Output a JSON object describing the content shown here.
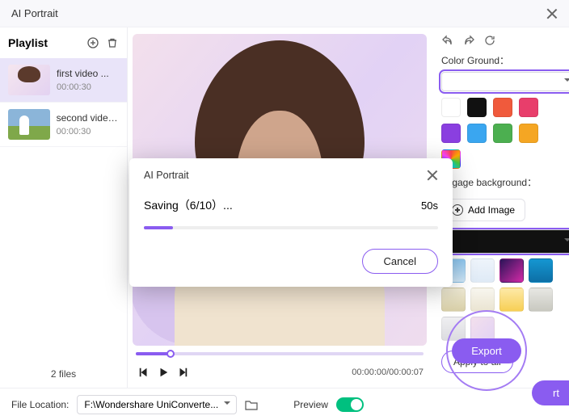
{
  "window": {
    "title": "AI Portrait"
  },
  "sidebar": {
    "label": "Playlist",
    "items": [
      {
        "name": "first video ...",
        "duration": "00:00:30"
      },
      {
        "name": "second video...",
        "duration": "00:00:30"
      }
    ],
    "file_count": "2 files"
  },
  "player": {
    "time_current": "00:00:00",
    "time_total": "00:00:07",
    "time_display": "00:00:00/00:00:07"
  },
  "right": {
    "color_ground_label": "Color Ground：",
    "image_bg_label": "Imgage background：",
    "add_image_label": "Add Image",
    "apply_all_label": "Apply to all",
    "export_label": "Export",
    "secondary_rt_label": "rt",
    "swatches": [
      "#ffffff",
      "#ffffff",
      "#111111",
      "#f05a3c",
      "#e83e6b",
      "#8a3fe0",
      "#3aa6f0",
      "#4caf50",
      "#f5a623",
      "rainbow"
    ],
    "bg_thumbs": [
      "#111111",
      "linear-gradient(135deg,#f6d5e8,#efe1f4)",
      "linear-gradient(135deg,#2e9e7a,#d3864e)",
      "linear-gradient(#1f4d7a,#0c2a47)",
      "linear-gradient(#8dc7f0,#cfe6f7)",
      "linear-gradient(#eef4fb,#dfeaf6)",
      "linear-gradient(135deg,#2a1458,#d32aa7)",
      "linear-gradient(#1596d1,#0d6fa6)",
      "linear-gradient(#f1ecd6,#d8cfa8)",
      "linear-gradient(#f8f6ef,#eae4d1)",
      "linear-gradient(#fde9a7,#f7cf55)",
      "linear-gradient(#e7e7e3,#c8c8c0)",
      "linear-gradient(#efeff1,#dcdce0)",
      "linear-gradient(135deg,#f3e0ec,#e2d2f5)",
      "",
      ""
    ]
  },
  "footer": {
    "file_location_label": "File Location:",
    "file_location_value": "F:\\Wondershare UniConverte...",
    "preview_label": "Preview",
    "preview_on": true
  },
  "modal": {
    "title": "AI Portrait",
    "status": "Saving（6/10）...",
    "eta": "50s",
    "cancel_label": "Cancel"
  }
}
